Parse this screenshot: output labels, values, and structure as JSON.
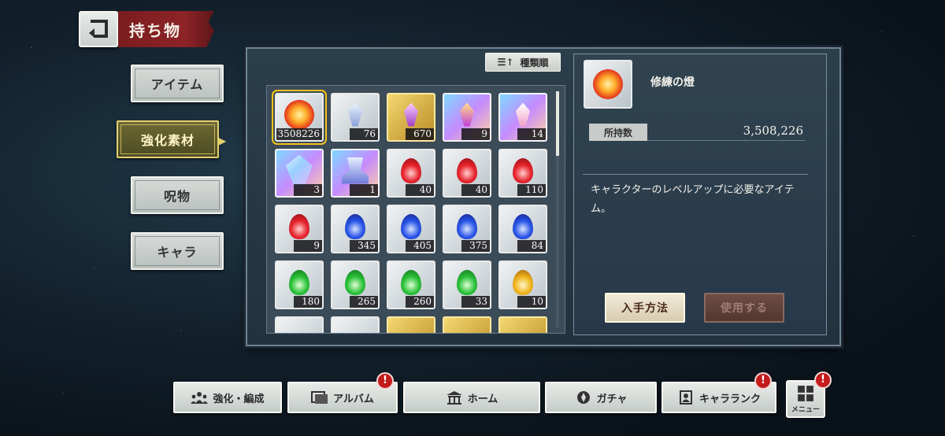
{
  "header": {
    "title": "持ち物"
  },
  "categories": [
    {
      "label": "アイテム",
      "active": false
    },
    {
      "label": "強化素材",
      "active": true
    },
    {
      "label": "呪物",
      "active": false
    },
    {
      "label": "キャラ",
      "active": false
    }
  ],
  "sort": {
    "label": "種類順"
  },
  "items": [
    {
      "kind": "orb",
      "count": "3508226",
      "frame": "plain",
      "selected": true
    },
    {
      "kind": "crystal-blue",
      "count": "76",
      "frame": "plain"
    },
    {
      "kind": "crystal-purple",
      "count": "670",
      "frame": "gold"
    },
    {
      "kind": "crystal-rainbow",
      "count": "9",
      "frame": "rainbow"
    },
    {
      "kind": "crystal-pink",
      "count": "14",
      "frame": "rainbow"
    },
    {
      "kind": "gem-rainbow",
      "count": "3",
      "frame": "rainbow"
    },
    {
      "kind": "altar",
      "count": "1",
      "frame": "rainbow"
    },
    {
      "kind": "flame-red",
      "count": "40",
      "frame": "plain"
    },
    {
      "kind": "flame-red",
      "count": "40",
      "frame": "plain"
    },
    {
      "kind": "flame-red",
      "count": "110",
      "frame": "plain"
    },
    {
      "kind": "flame-red",
      "count": "9",
      "frame": "plain"
    },
    {
      "kind": "flame-blue",
      "count": "345",
      "frame": "plain"
    },
    {
      "kind": "flame-blue",
      "count": "405",
      "frame": "plain"
    },
    {
      "kind": "flame-blue",
      "count": "375",
      "frame": "plain"
    },
    {
      "kind": "flame-blue",
      "count": "84",
      "frame": "plain"
    },
    {
      "kind": "flame-green",
      "count": "180",
      "frame": "plain"
    },
    {
      "kind": "flame-green",
      "count": "265",
      "frame": "plain"
    },
    {
      "kind": "flame-green",
      "count": "260",
      "frame": "plain"
    },
    {
      "kind": "flame-green",
      "count": "33",
      "frame": "plain"
    },
    {
      "kind": "flame-yellow",
      "count": "10",
      "frame": "plain"
    },
    {
      "kind": "partial",
      "count": "",
      "frame": "plain"
    },
    {
      "kind": "partial",
      "count": "",
      "frame": "plain"
    },
    {
      "kind": "partial",
      "count": "",
      "frame": "gold"
    },
    {
      "kind": "partial",
      "count": "",
      "frame": "gold"
    },
    {
      "kind": "partial",
      "count": "",
      "frame": "gold"
    }
  ],
  "detail": {
    "name": "修練の燈",
    "owned_label": "所持数",
    "owned_value": "3,508,226",
    "description": "キャラクターのレベルアップに必要なアイテム。",
    "obtain_label": "入手方法",
    "use_label": "使用する"
  },
  "nav": {
    "enhance": "強化・編成",
    "album": "アルバム",
    "home": "ホーム",
    "gacha": "ガチャ",
    "rank": "キャラランク",
    "menu": "メニュー",
    "badge": "!"
  },
  "colors": {
    "accent_red": "#8d2428",
    "active_gold": "#e3cf72",
    "badge_red": "#c31b1b"
  }
}
